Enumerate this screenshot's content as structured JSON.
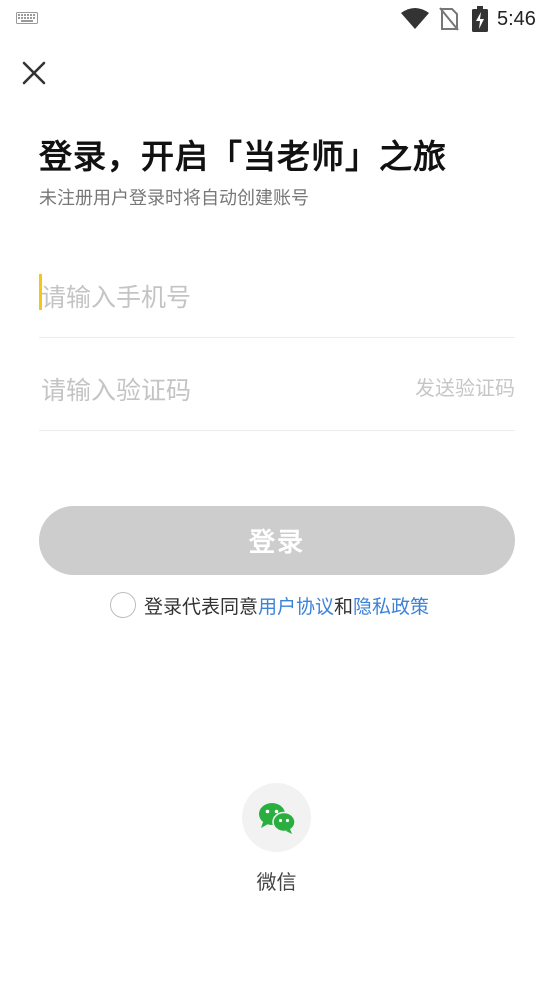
{
  "status_bar": {
    "time": "5:46",
    "icons": [
      "keyboard-icon",
      "wifi-icon",
      "no-sim-icon",
      "battery-charging-icon"
    ]
  },
  "header": {
    "close_icon": "close-icon",
    "title": "登录，开启「当老师」之旅",
    "subtitle": "未注册用户登录时将自动创建账号"
  },
  "form": {
    "phone_placeholder": "请输入手机号",
    "phone_value": "",
    "code_placeholder": "请输入验证码",
    "code_value": "",
    "send_code_label": "发送验证码",
    "login_label": "登录"
  },
  "agreement": {
    "checked": false,
    "prefix": "登录代表同意",
    "user_agreement": "用户协议",
    "and": "和",
    "privacy_policy": "隐私政策"
  },
  "social": {
    "wechat_label": "微信",
    "wechat_icon": "wechat-icon"
  },
  "colors": {
    "accent_caret": "#f5c518",
    "link": "#3b82d9",
    "button_disabled": "#cdcdcd",
    "wechat_green": "#2aae3f"
  }
}
